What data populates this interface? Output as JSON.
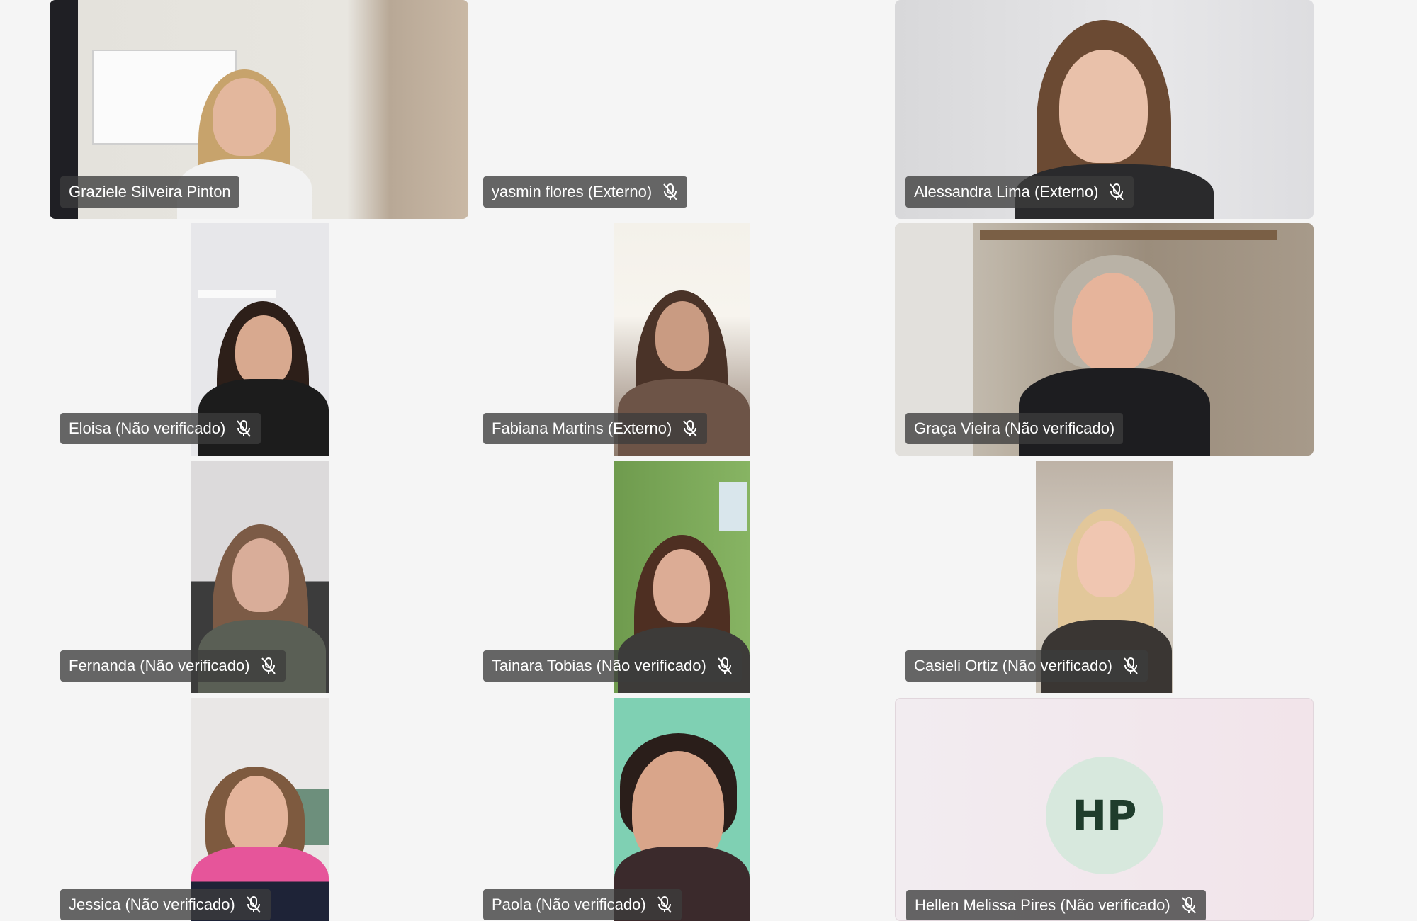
{
  "participants": [
    {
      "name": "Graziele Silveira Pinton",
      "muted": false
    },
    {
      "name": "yasmin flores (Externo)",
      "muted": true
    },
    {
      "name": "Alessandra Lima (Externo)",
      "muted": true
    },
    {
      "name": "Eloisa (Não verificado)",
      "muted": true
    },
    {
      "name": "Fabiana Martins (Externo)",
      "muted": true
    },
    {
      "name": "Graça Vieira (Não verificado)",
      "muted": false
    },
    {
      "name": "Fernanda (Não verificado)",
      "muted": true
    },
    {
      "name": "Tainara Tobias (Não verificado)",
      "muted": true
    },
    {
      "name": "Casieli Ortiz (Não verificado)",
      "muted": true
    },
    {
      "name": "Jessica (Não verificado)",
      "muted": true
    },
    {
      "name": "Paola (Não verificado)",
      "muted": true
    },
    {
      "name": "Hellen Melissa Pires (Não verificado)",
      "muted": true,
      "initials": "HP"
    }
  ],
  "icons": {
    "mic": "mic-off-icon",
    "avatar": "initials-avatar"
  },
  "colors": {
    "background": "#f5f5f5",
    "chip": "#3c3c3c",
    "avatar": "#d7e8dd",
    "avatar_text": "#1f3d2c"
  }
}
